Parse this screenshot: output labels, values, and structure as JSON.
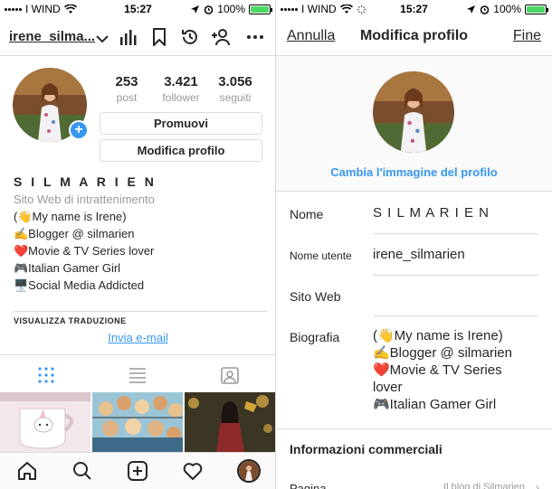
{
  "status": {
    "carrier": "I WIND",
    "time": "15:27",
    "battery": "100%",
    "battery_level": 1.0
  },
  "profile": {
    "username": "irene_silma...",
    "stats": [
      {
        "number": "253",
        "label": "post"
      },
      {
        "number": "3.421",
        "label": "follower"
      },
      {
        "number": "3.056",
        "label": "seguiti"
      }
    ],
    "promote_label": "Promuovi",
    "edit_label": "Modifica profilo",
    "full_name": "S I L M A R I E N",
    "category": "Sito Web di intrattenimento",
    "bio_lines": [
      "(👋My name is Irene)",
      "✍Blogger @ silmarien",
      "❤️Movie & TV Series lover",
      "🎮Italian Gamer Girl",
      "🖥️Social Media Addicted"
    ],
    "translate_label": "VISUALIZZA TRADUZIONE",
    "email_label": "Invia e-mail"
  },
  "edit": {
    "cancel": "Annulla",
    "title": "Modifica profilo",
    "done": "Fine",
    "change_photo": "Cambia l'immagine del profilo",
    "fields": {
      "name_label": "Nome",
      "name_value": "S I L M A R I E N",
      "username_label": "Nome utente",
      "username_value": "irene_silmarien",
      "website_label": "Sito Web",
      "website_value": "",
      "bio_label": "Biografia"
    },
    "bio_lines": [
      "(👋My name is Irene)",
      "✍Blogger @ silmarien",
      "❤️Movie & TV Series",
      "lover",
      "🎮Italian Gamer Girl"
    ],
    "business_title": "Informazioni commerciali",
    "page_label": "Pagina",
    "page_value": "Il blog di Silmarien"
  },
  "colors": {
    "accent": "#3897f0",
    "border": "#dbdbdb",
    "muted": "#999999",
    "battery": "#4cd964"
  },
  "icons": {
    "header": [
      "chevron-down-icon",
      "bar-chart-icon",
      "bookmark-icon",
      "history-icon",
      "add-person-icon",
      "more-icon"
    ],
    "tabs": [
      "grid-icon",
      "list-icon",
      "tagged-icon"
    ],
    "bottom_nav": [
      "home-icon",
      "search-icon",
      "add-post-icon",
      "heart-icon",
      "profile-avatar"
    ]
  }
}
